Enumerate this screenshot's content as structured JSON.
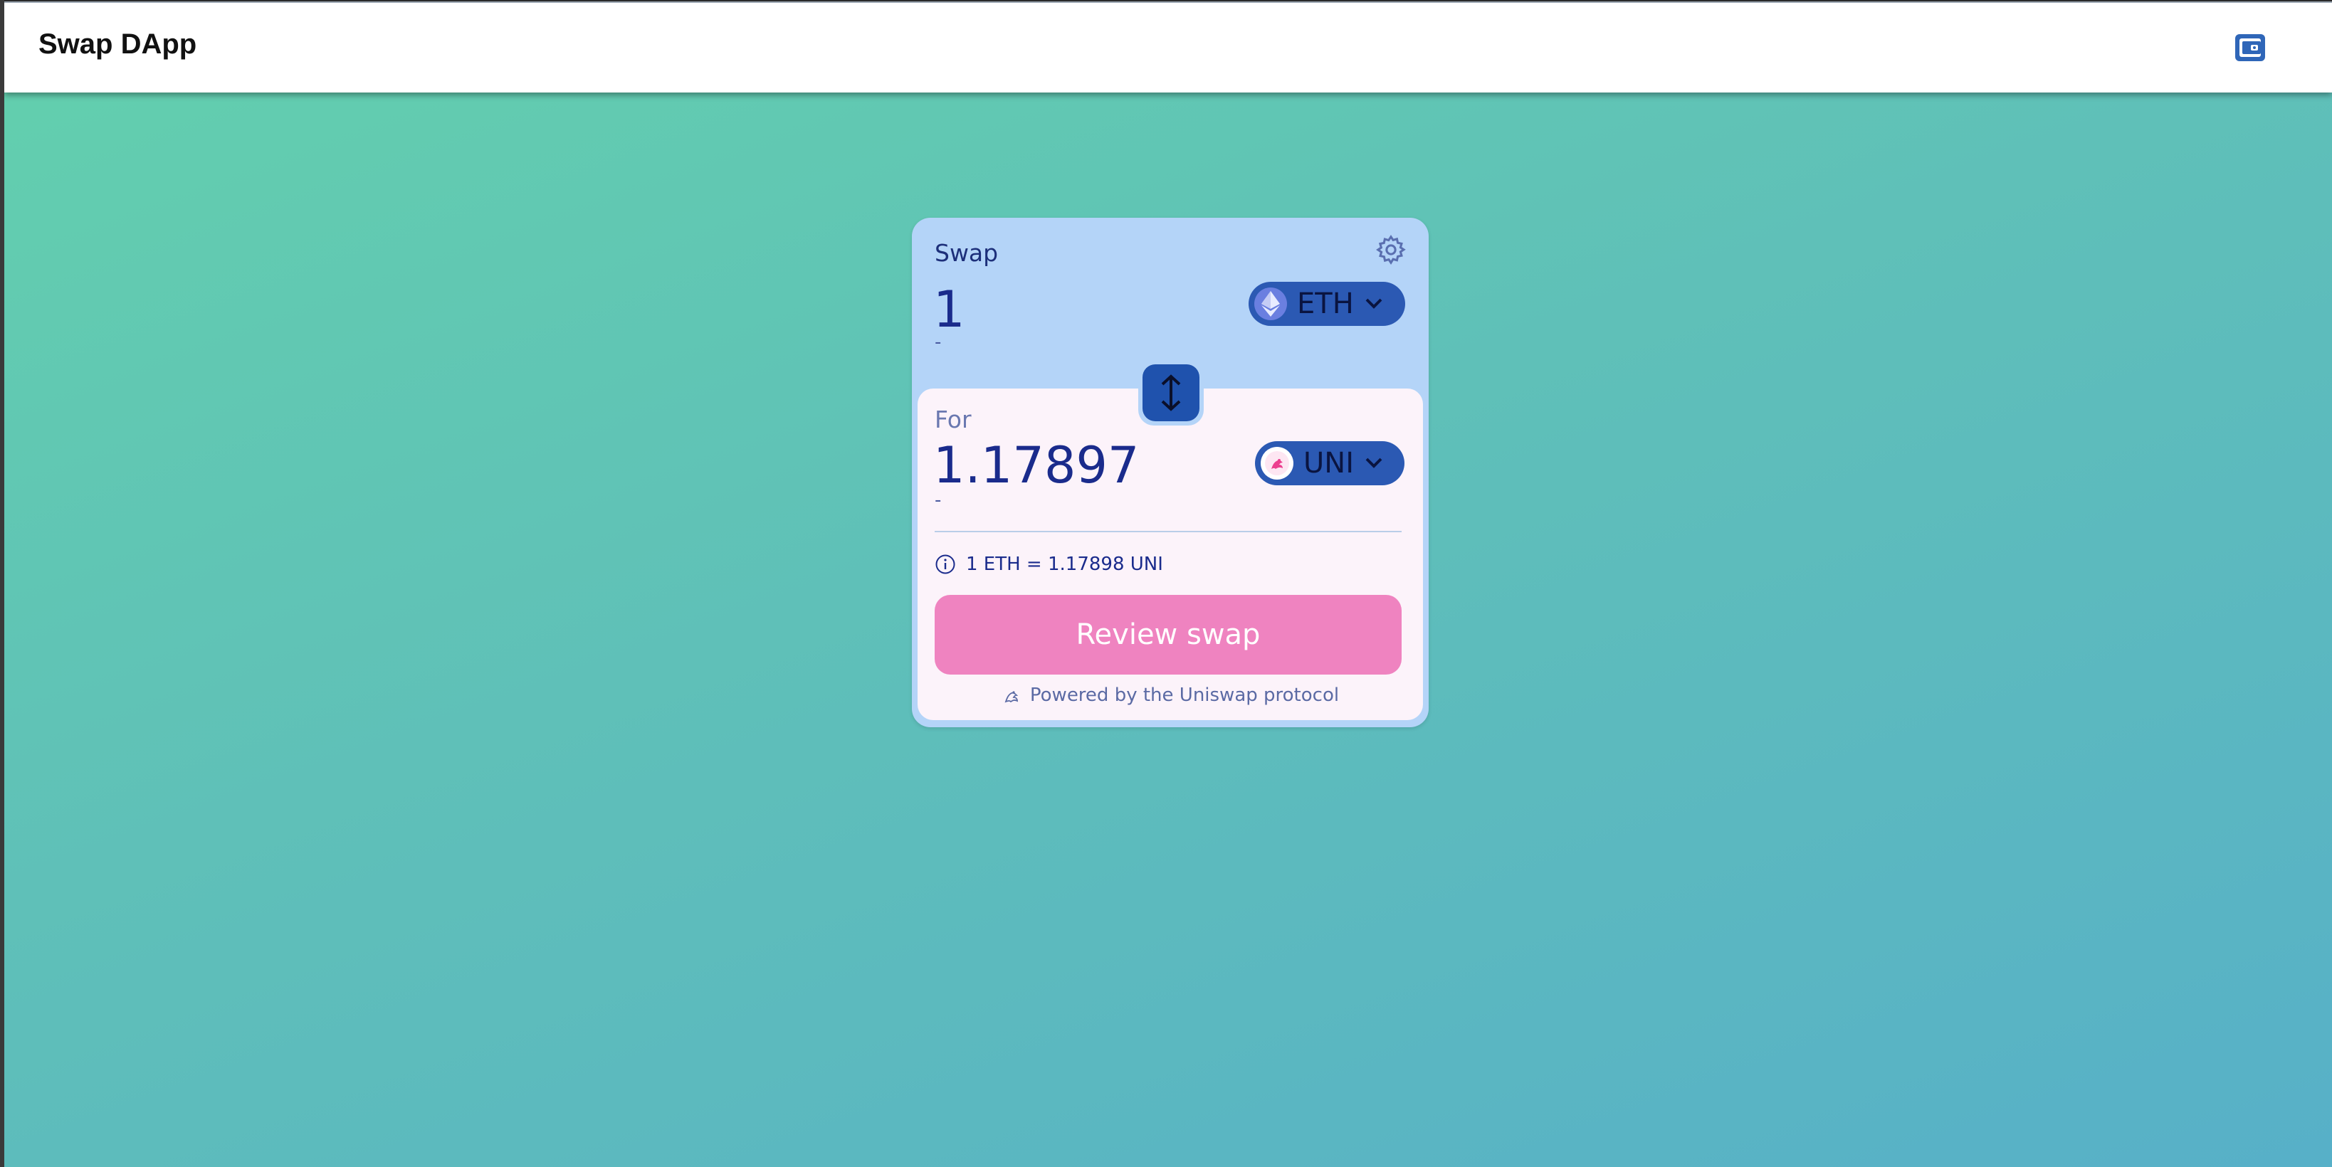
{
  "app": {
    "title": "Swap DApp"
  },
  "swap": {
    "label": "Swap",
    "sell": {
      "amount": "1",
      "usd": "-",
      "token": "ETH"
    },
    "buy": {
      "label": "For",
      "amount": "1.17897",
      "usd": "-",
      "token": "UNI"
    },
    "rate": "1 ETH = 1.17898 UNI",
    "review_label": "Review swap",
    "powered_by": "Powered by the Uniswap protocol"
  },
  "colors": {
    "card_bg": "#b4d4f8",
    "buy_panel_bg": "#fcf3fa",
    "token_button": "#2b59b3",
    "review_button": "#ef83c0",
    "amount_text": "#1a2b8c"
  },
  "icons": {
    "wallet": "wallet-icon",
    "settings": "gear-icon",
    "flip": "swap-arrows-icon",
    "eth": "ethereum-logo-icon",
    "uni": "uniswap-logo-icon",
    "info": "info-icon",
    "chevron": "chevron-down-icon"
  }
}
